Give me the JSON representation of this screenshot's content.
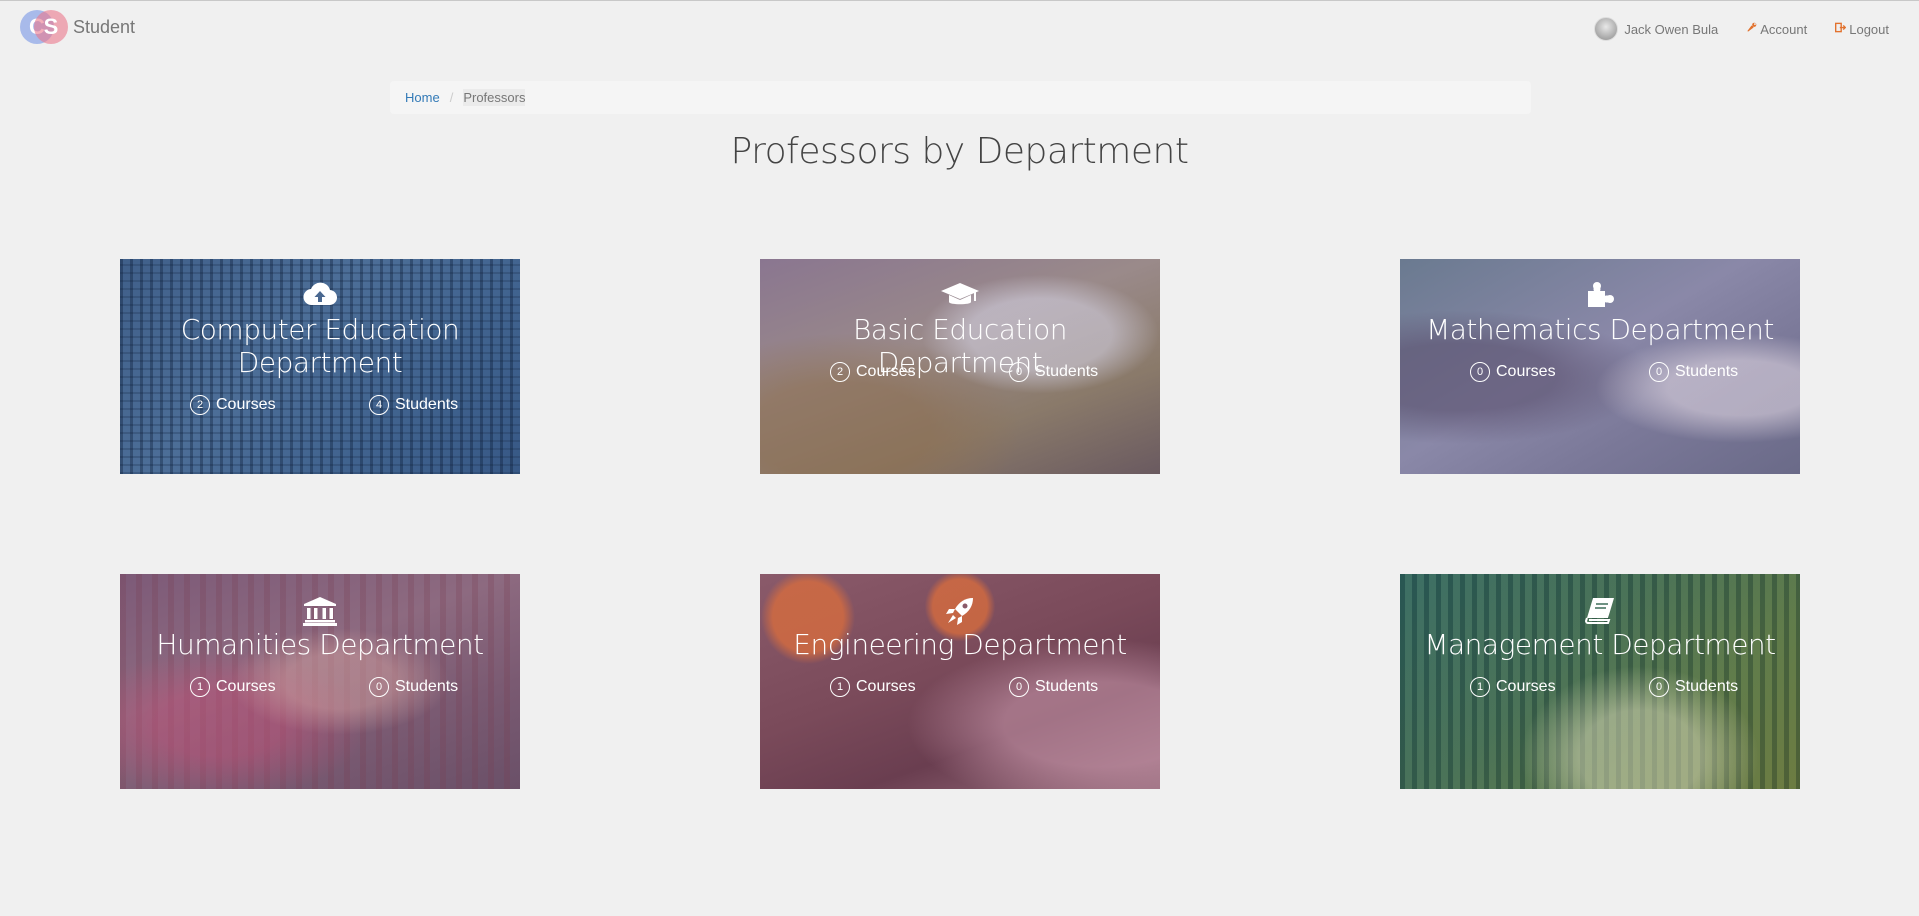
{
  "brand": {
    "name": "Student",
    "logo_letters": [
      "C",
      "S"
    ]
  },
  "nav": {
    "user_name": "Jack Owen Bula",
    "account_label": "Account",
    "logout_label": "Logout"
  },
  "breadcrumb": {
    "home": "Home",
    "separator": "/",
    "current": "Professors"
  },
  "page_title": "Professors by Department",
  "departments": [
    {
      "name": "Computer Education Department",
      "icon": "cloud-upload-icon",
      "courses": "2",
      "students": "4",
      "courses_label": "Courses",
      "students_label": "Students"
    },
    {
      "name": "Basic Education Department",
      "icon": "graduation-cap-icon",
      "courses": "2",
      "students": "0",
      "courses_label": "Courses",
      "students_label": "Students"
    },
    {
      "name": "Mathematics Department",
      "icon": "puzzle-piece-icon",
      "courses": "0",
      "students": "0",
      "courses_label": "Courses",
      "students_label": "Students"
    },
    {
      "name": "Humanities Department",
      "icon": "institution-icon",
      "courses": "1",
      "students": "0",
      "courses_label": "Courses",
      "students_label": "Students"
    },
    {
      "name": "Engineering Department",
      "icon": "rocket-icon",
      "courses": "1",
      "students": "0",
      "courses_label": "Courses",
      "students_label": "Students"
    },
    {
      "name": "Management Department",
      "icon": "book-icon",
      "courses": "1",
      "students": "0",
      "courses_label": "Courses",
      "students_label": "Students"
    }
  ]
}
